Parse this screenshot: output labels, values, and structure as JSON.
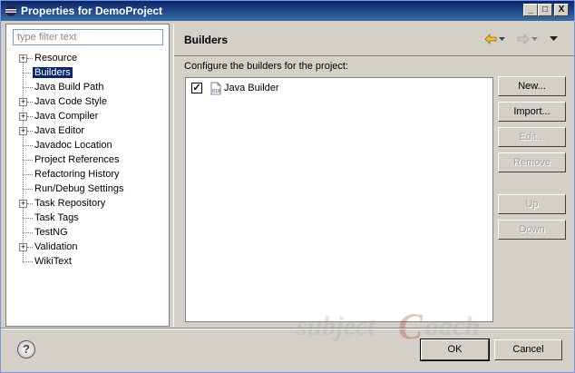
{
  "window": {
    "title": "Properties for DemoProject",
    "min_glyph": "_",
    "max_glyph": "□",
    "close_glyph": "X"
  },
  "filter": {
    "placeholder": "type filter text"
  },
  "tree": {
    "items": [
      {
        "label": "Resource",
        "expandable": true,
        "selected": false
      },
      {
        "label": "Builders",
        "expandable": false,
        "selected": true
      },
      {
        "label": "Java Build Path",
        "expandable": false,
        "selected": false
      },
      {
        "label": "Java Code Style",
        "expandable": true,
        "selected": false
      },
      {
        "label": "Java Compiler",
        "expandable": true,
        "selected": false
      },
      {
        "label": "Java Editor",
        "expandable": true,
        "selected": false
      },
      {
        "label": "Javadoc Location",
        "expandable": false,
        "selected": false
      },
      {
        "label": "Project References",
        "expandable": false,
        "selected": false
      },
      {
        "label": "Refactoring History",
        "expandable": false,
        "selected": false
      },
      {
        "label": "Run/Debug Settings",
        "expandable": false,
        "selected": false
      },
      {
        "label": "Task Repository",
        "expandable": true,
        "selected": false
      },
      {
        "label": "Task Tags",
        "expandable": false,
        "selected": false
      },
      {
        "label": "TestNG",
        "expandable": false,
        "selected": false
      },
      {
        "label": "Validation",
        "expandable": true,
        "selected": false
      },
      {
        "label": "WikiText",
        "expandable": false,
        "selected": false
      }
    ]
  },
  "page": {
    "title": "Builders",
    "description": "Configure the builders for the project:",
    "nav_icons": [
      "back-arrow-icon",
      "back-dropdown-icon",
      "forward-arrow-icon",
      "forward-dropdown-icon",
      "view-menu-icon"
    ],
    "builders": [
      {
        "label": "Java Builder",
        "checked": true,
        "icon": "java-builder-icon"
      }
    ],
    "buttons": [
      {
        "label": "New...",
        "enabled": true
      },
      {
        "label": "Import...",
        "enabled": true
      },
      {
        "label": "Edit...",
        "enabled": false
      },
      {
        "label": "Remove",
        "enabled": false
      },
      {
        "label": "Up",
        "enabled": false
      },
      {
        "label": "Down",
        "enabled": false
      }
    ]
  },
  "footer": {
    "help_glyph": "?",
    "ok_label": "OK",
    "cancel_label": "Cancel"
  },
  "watermark": {
    "text": "subjectCoach"
  },
  "colors": {
    "selection": "#0a246a",
    "title_bar": "#0a246a",
    "dialog_bg": "#d4d0c8",
    "watermark": "#c0392b"
  }
}
